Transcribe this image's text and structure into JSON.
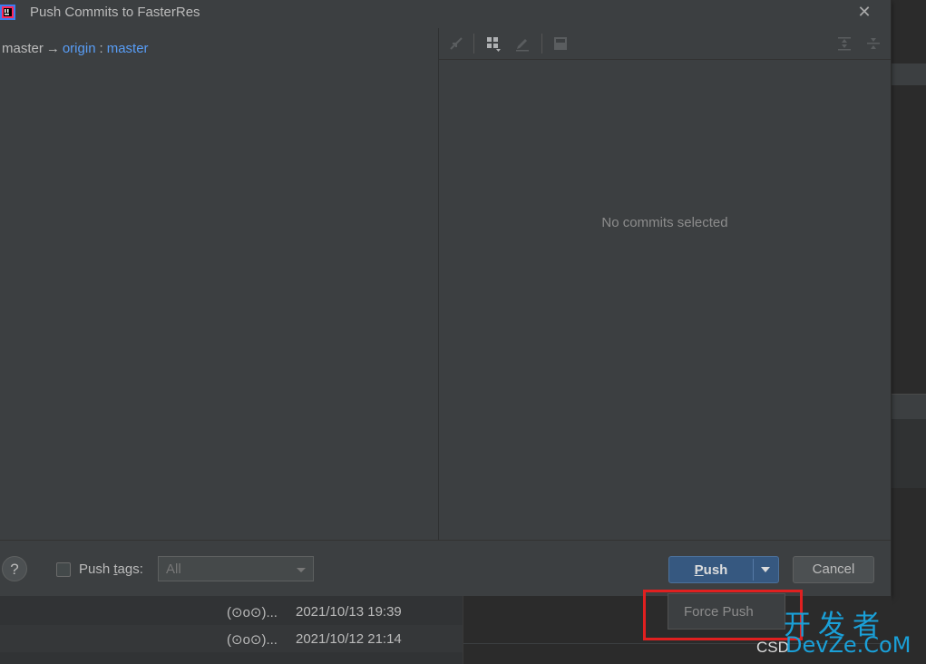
{
  "dialog": {
    "title": "Push Commits to FasterRes",
    "close_icon": "close-icon"
  },
  "branch": {
    "local": "master",
    "arrow": "→",
    "remote": "origin",
    "colon": ":",
    "remote_branch": "master"
  },
  "details": {
    "empty_text": "No commits selected",
    "toolbar_icons": [
      "collapse-icon",
      "grouping-icon",
      "edit-icon",
      "save-icon",
      "expand-all-icon",
      "collapse-all-icon"
    ]
  },
  "footer": {
    "help_label": "?",
    "push_tags_prefix": "Push ",
    "push_tags_mnemonic": "t",
    "push_tags_suffix": "ags:",
    "tags_select_value": "All",
    "push_mnemonic": "P",
    "push_rest": "ush",
    "cancel_label": "Cancel"
  },
  "popup": {
    "force_push": "Force Push"
  },
  "background_rows": [
    {
      "author": "(⊙o⊙)...",
      "date": "2021/10/13 19:39"
    },
    {
      "author": "(⊙o⊙)...",
      "date": "2021/10/12 21:14"
    }
  ],
  "watermark": {
    "cn": "开发者",
    "en": "DevZe.CoM",
    "csdn": "CSD"
  },
  "colors": {
    "link": "#589df6",
    "primary_button": "#365880",
    "highlight": "#e02020",
    "watermark": "#1aa0d8"
  }
}
